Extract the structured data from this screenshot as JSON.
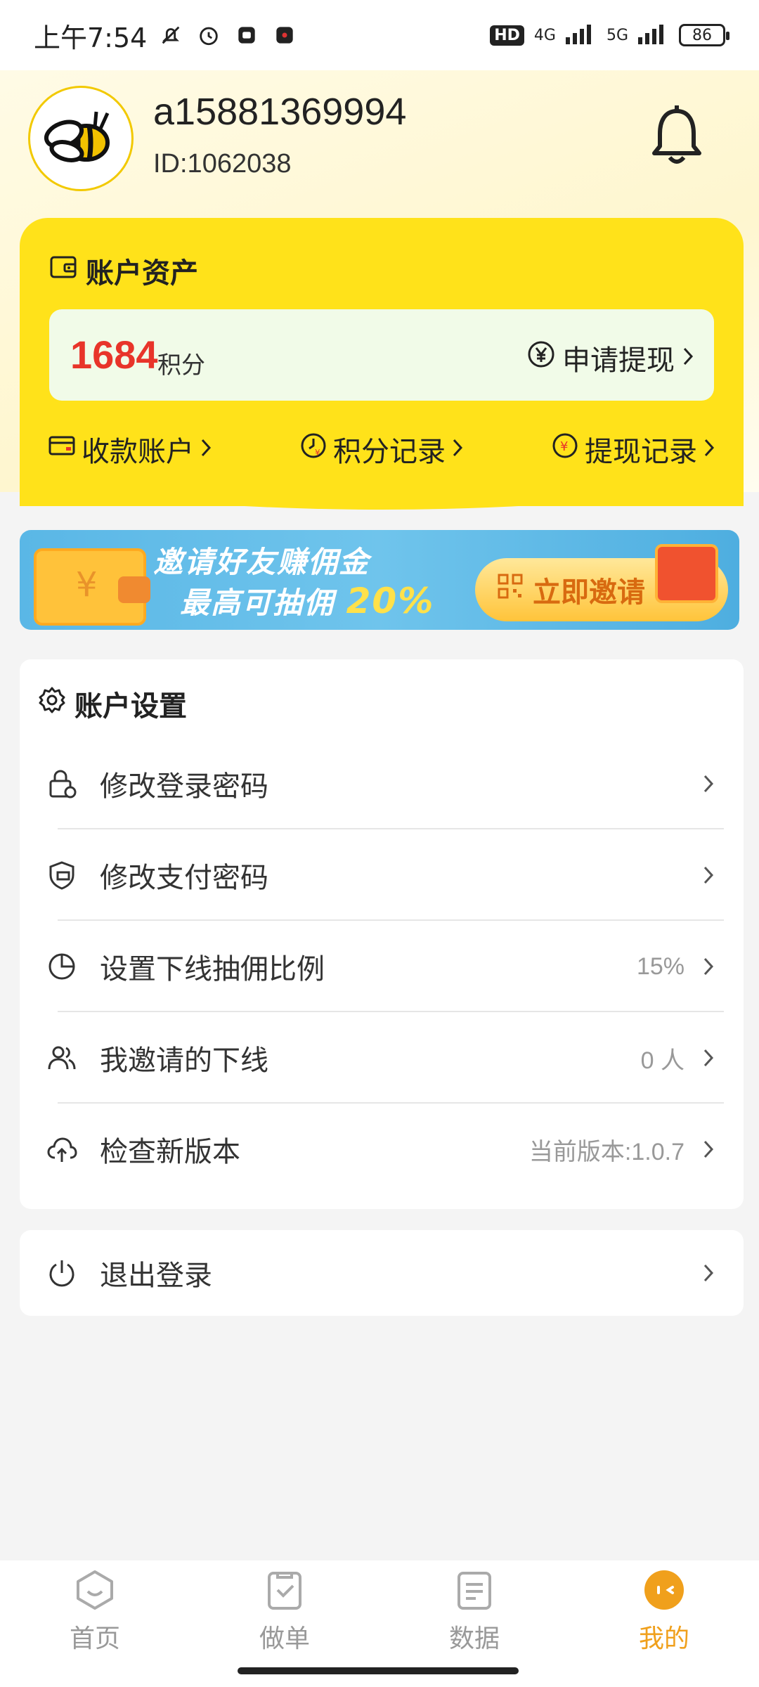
{
  "status_bar": {
    "time": "上午7:54",
    "hd_label": "HD",
    "net_4g": "4G",
    "net_5g": "5G",
    "battery": "86"
  },
  "profile": {
    "username": "a15881369994",
    "user_id": "ID:1062038"
  },
  "assets": {
    "title": "账户资产",
    "points_value": "1684",
    "points_unit": "积分",
    "withdraw_label": "申请提现",
    "links": [
      {
        "label": "收款账户"
      },
      {
        "label": "积分记录"
      },
      {
        "label": "提现记录"
      }
    ]
  },
  "banner": {
    "line1": "邀请好友赚佣金",
    "line2_prefix": "最高可抽佣",
    "line2_pct": "20%",
    "button_label": "立即邀请"
  },
  "settings": {
    "title": "账户设置",
    "rows": [
      {
        "label": "修改登录密码",
        "value": ""
      },
      {
        "label": "修改支付密码",
        "value": ""
      },
      {
        "label": "设置下线抽佣比例",
        "value": "15%"
      },
      {
        "label": "我邀请的下线",
        "value": "0 人"
      },
      {
        "label": "检查新版本",
        "value": "当前版本:1.0.7"
      }
    ]
  },
  "logout": {
    "label": "退出登录"
  },
  "nav": {
    "items": [
      {
        "label": "首页"
      },
      {
        "label": "做单"
      },
      {
        "label": "数据"
      },
      {
        "label": "我的"
      }
    ],
    "active_color": "#f0a01c"
  },
  "colors": {
    "accent_yellow": "#ffe21a",
    "points_red": "#e8342a"
  }
}
